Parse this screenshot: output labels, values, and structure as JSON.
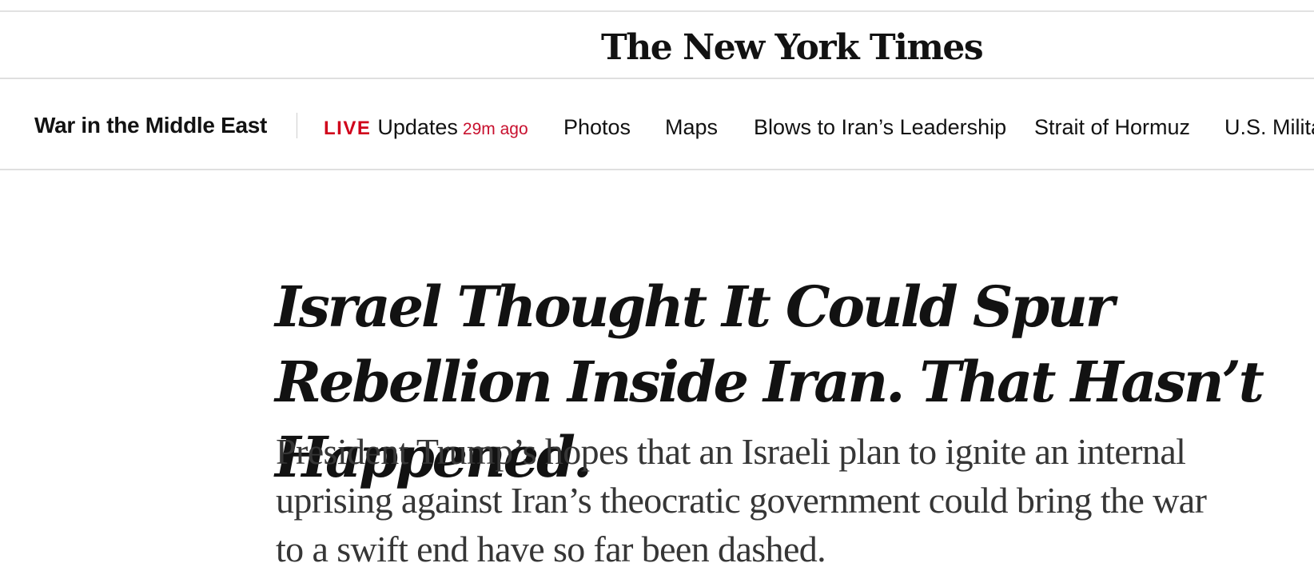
{
  "masthead": {
    "logo_text": "The New York Times"
  },
  "section_nav": {
    "section_title": "War in the Middle East",
    "live": {
      "badge": "LIVE",
      "label": "Updates",
      "time": "29m ago"
    },
    "links": [
      {
        "label": "Photos"
      },
      {
        "label": "Maps"
      },
      {
        "label": "Blows to Iran’s Leadership"
      },
      {
        "label": "Strait of Hormuz"
      },
      {
        "label": "U.S. Milita"
      }
    ]
  },
  "article": {
    "headline": "Israel Thought It Could Spur Rebellion Inside Iran. That Hasn’t Happened.",
    "summary": "President Trump’s hopes that an Israeli plan to ignite an internal uprising against Iran’s theocratic government could bring the war to a swift end have so far been dashed."
  },
  "colors": {
    "live_red": "#d0021b",
    "text": "#121212",
    "summary_text": "#363636",
    "rule": "#dfdfdf"
  }
}
